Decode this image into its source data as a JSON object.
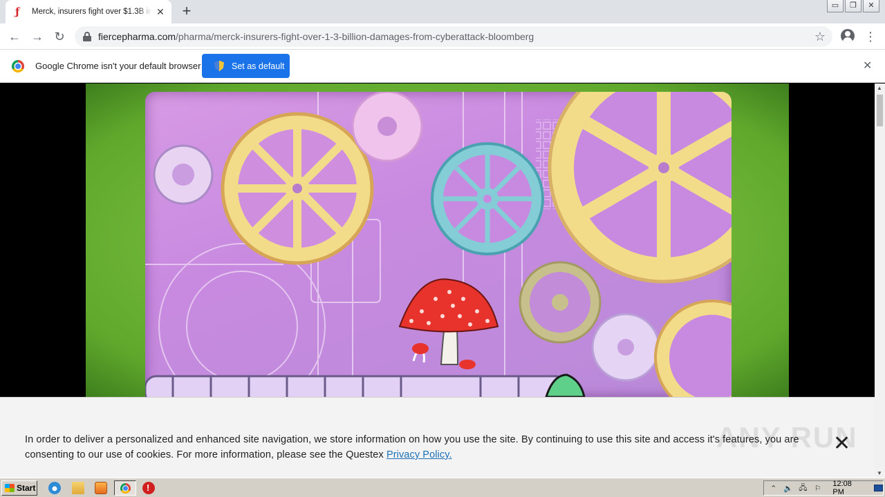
{
  "tab": {
    "title": "Merck, insurers fight over $1.3B in d",
    "favicon_glyph": "ƒ",
    "close_glyph": "✕"
  },
  "new_tab_glyph": "+",
  "window_controls": [
    "▭",
    "❐",
    "✕"
  ],
  "toolbar": {
    "back_glyph": "←",
    "forward_glyph": "→",
    "reload_glyph": "↻",
    "url_domain": "fiercepharma.com",
    "url_path": "/pharma/merck-insurers-fight-over-1-3-billion-damages-from-cyberattack-bloomberg",
    "star_glyph": "☆",
    "menu_glyph": "⋮"
  },
  "infobar": {
    "message": "Google Chrome isn't your default browser",
    "button_label": "Set as default",
    "close_glyph": "✕"
  },
  "scrollbar": {
    "up_glyph": "▲",
    "down_glyph": "▼"
  },
  "cookie_banner": {
    "text": "In order to deliver a personalized and enhanced site navigation, we store information on how you use the site. By continuing to use this site and access it's features, you are consenting to our use of cookies. For more information, please see the Questex ",
    "link_text": "Privacy Policy.",
    "close_glyph": "✕",
    "watermark": "ANY RUN"
  },
  "taskbar": {
    "start_label": "Start",
    "tray_icons": [
      "⌃",
      "🔈",
      "🖧",
      "⚐"
    ],
    "clock": "12:08 PM"
  },
  "icons": {
    "tab_favicon": "fiercepharma-favicon-icon",
    "lock": "lock-icon",
    "shield": "shield-icon",
    "chrome": "chrome-logo-icon"
  }
}
